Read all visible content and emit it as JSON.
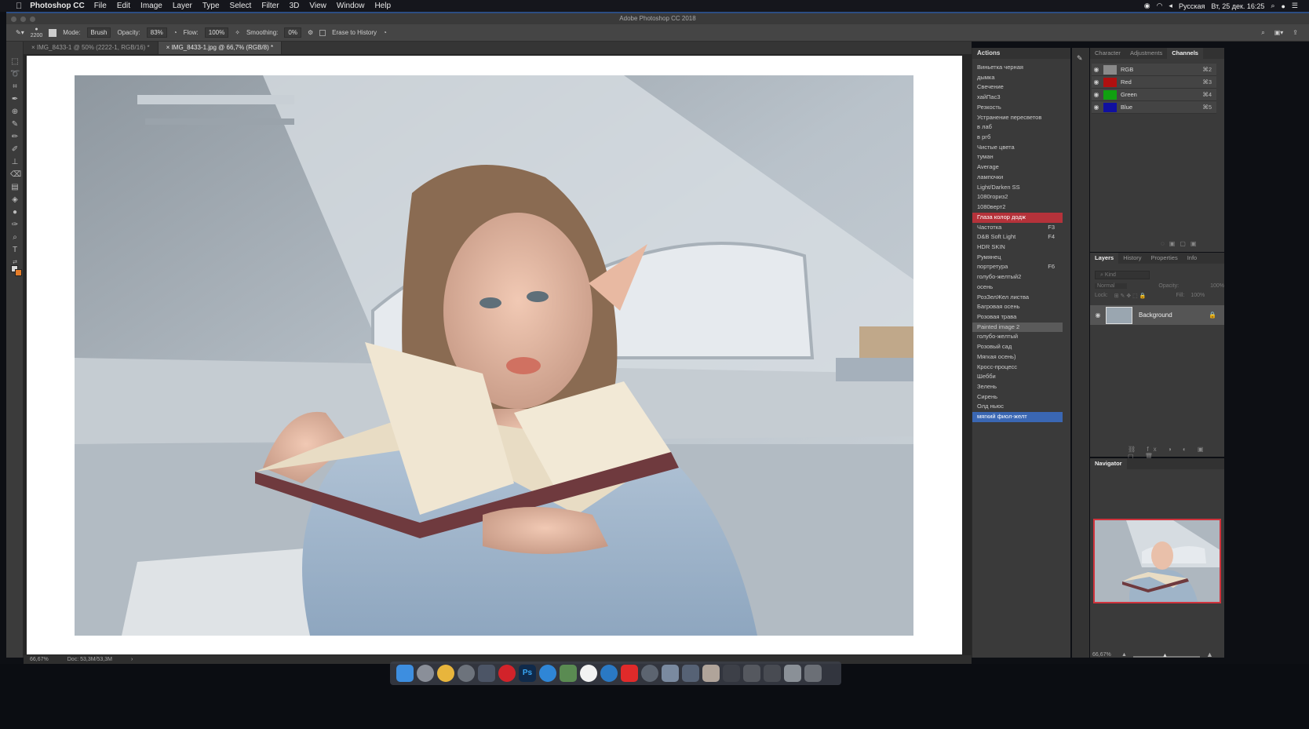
{
  "menubar": {
    "app": "Photoshop CC",
    "items": [
      "File",
      "Edit",
      "Image",
      "Layer",
      "Type",
      "Select",
      "Filter",
      "3D",
      "View",
      "Window",
      "Help"
    ],
    "lang": "Русская",
    "clock": "Вт, 25 дек. 16:25"
  },
  "window": {
    "title": "Adobe Photoshop CC 2018"
  },
  "options": {
    "brush_size": "2200",
    "mode_label": "Mode:",
    "mode": "Brush",
    "opacity_label": "Opacity:",
    "opacity": "83%",
    "flow_label": "Flow:",
    "flow": "100%",
    "smoothing_label": "Smoothing:",
    "smoothing": "0%",
    "erase_history": "Erase to History"
  },
  "tabs": [
    {
      "label": "IMG_8433-1 @ 50% (2222-1, RGB/16) *"
    },
    {
      "label": "IMG_8433-1.jpg @ 66,7% (RGB/8) *"
    }
  ],
  "status": {
    "zoom": "66,67%",
    "doc": "Doc: 53,3M/53,3M"
  },
  "actions": {
    "title": "Actions",
    "items": [
      {
        "label": "Виньетка черная",
        "key": ""
      },
      {
        "label": "дымка",
        "key": ""
      },
      {
        "label": "Свечение",
        "key": ""
      },
      {
        "label": "хайПас3",
        "key": ""
      },
      {
        "label": "Резкость",
        "key": ""
      },
      {
        "label": "Устранение пересветов",
        "key": ""
      },
      {
        "label": "в лаб",
        "key": ""
      },
      {
        "label": "в ргб",
        "key": ""
      },
      {
        "label": "Чистые цвета",
        "key": ""
      },
      {
        "label": "туман",
        "key": ""
      },
      {
        "label": "Average",
        "key": ""
      },
      {
        "label": "лампочки",
        "key": ""
      },
      {
        "label": "Light/Darken SS",
        "key": ""
      },
      {
        "label": "1080гориз2",
        "key": ""
      },
      {
        "label": "1080верт2",
        "key": ""
      },
      {
        "label": "Глаза колор додж",
        "key": ""
      },
      {
        "label": "Частотка",
        "key": "F3"
      },
      {
        "label": "D&B Soft Light",
        "key": "F4"
      },
      {
        "label": "HDR SKIN",
        "key": ""
      },
      {
        "label": "Румянец",
        "key": ""
      },
      {
        "label": "портретура",
        "key": "F6"
      },
      {
        "label": "голубо-желтый2",
        "key": ""
      },
      {
        "label": "осень",
        "key": ""
      },
      {
        "label": "РозЗелЖел листва",
        "key": ""
      },
      {
        "label": "Багровая осень",
        "key": ""
      },
      {
        "label": "Розовая трава",
        "key": ""
      },
      {
        "label": "Painted image 2",
        "key": ""
      },
      {
        "label": "голубо-желтый",
        "key": ""
      },
      {
        "label": "Розовый сад",
        "key": ""
      },
      {
        "label": "Мягкая осень)",
        "key": ""
      },
      {
        "label": "Кросс-процесс",
        "key": ""
      },
      {
        "label": "Шебби",
        "key": ""
      },
      {
        "label": "Зелень",
        "key": ""
      },
      {
        "label": "Сирень",
        "key": ""
      },
      {
        "label": "Олд ньюс",
        "key": ""
      },
      {
        "label": "мягкий фиол-желт",
        "key": ""
      }
    ]
  },
  "channels_panel": {
    "tabs": [
      "Character",
      "Adjustments",
      "Channels"
    ],
    "rows": [
      {
        "name": "RGB",
        "key": "⌘2",
        "color": "#8a8a8a"
      },
      {
        "name": "Red",
        "key": "⌘3",
        "color": "#b01010"
      },
      {
        "name": "Green",
        "key": "⌘4",
        "color": "#10a010"
      },
      {
        "name": "Blue",
        "key": "⌘5",
        "color": "#1010a0"
      }
    ]
  },
  "layers_panel": {
    "tabs": [
      "Layers",
      "History",
      "Properties",
      "Info"
    ],
    "kind": "Kind",
    "blend": "Normal",
    "opacity_label": "Opacity:",
    "opacity": "100%",
    "lock_label": "Lock:",
    "fill_label": "Fill:",
    "fill": "100%",
    "layer": "Background"
  },
  "navigator": {
    "title": "Navigator",
    "zoom": "66,67%"
  }
}
